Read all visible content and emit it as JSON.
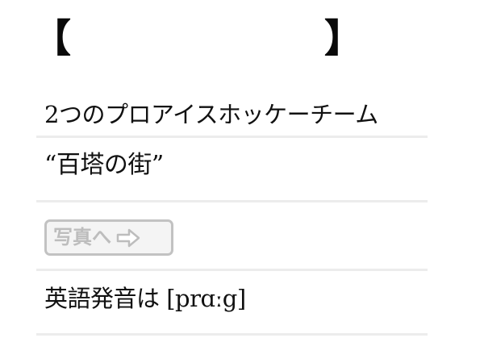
{
  "header": {
    "left_bracket": "【",
    "right_bracket": "】"
  },
  "rows": [
    {
      "text": "2つのプロアイスホッケーチーム"
    },
    {
      "text": "“百塔の街”"
    },
    {
      "button_label": "写真へ",
      "button_icon": "right-arrow-icon"
    },
    {
      "text": "英語発音は [prɑːg]"
    }
  ],
  "colors": {
    "text": "#111111",
    "divider": "#ececec",
    "button_border": "#c2c2c2",
    "button_text": "#bdbdbd"
  }
}
